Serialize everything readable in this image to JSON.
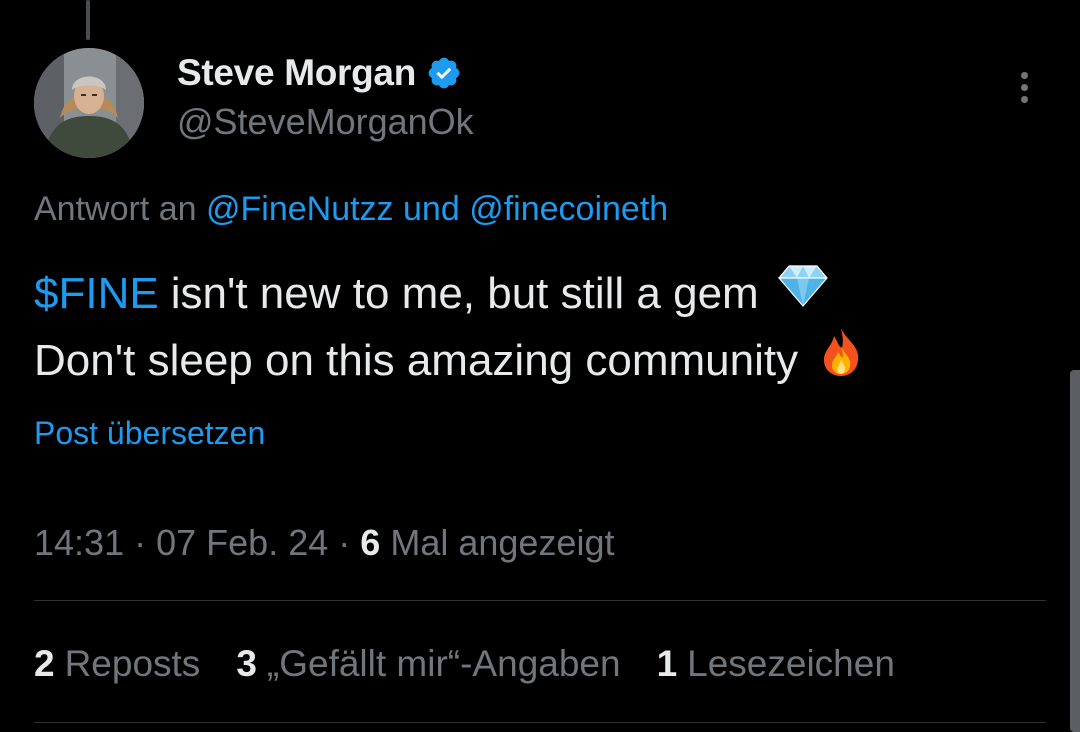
{
  "colors": {
    "background": "#000000",
    "text_primary": "#e7e9ea",
    "text_secondary": "#71767b",
    "accent": "#1d9bf0",
    "divider": "#2f3336"
  },
  "author": {
    "display_name": "Steve Morgan",
    "handle": "@SteveMorganOk",
    "verified": true,
    "avatar_icon": "profile-photo"
  },
  "reply": {
    "prefix": "Antwort an",
    "mention_1": "@FineNutzz",
    "connector": "und",
    "mention_2": "@finecoineth"
  },
  "tweet": {
    "line1_cashtag": "$FINE",
    "line1_text": "isn't new to me, but still a gem",
    "line1_emoji": "gem-stone-icon",
    "line2_text": "Don't sleep on this amazing community",
    "line2_emoji": "fire-icon"
  },
  "translate_label": "Post übersetzen",
  "meta": {
    "time": "14:31",
    "separator": "·",
    "date": "07 Feb. 24",
    "views_count": "6",
    "views_label": "Mal angezeigt"
  },
  "stats": {
    "reposts_count": "2",
    "reposts_label": "Reposts",
    "likes_count": "3",
    "likes_label": "„Gefällt mir“-Angaben",
    "bookmarks_count": "1",
    "bookmarks_label": "Lesezeichen"
  }
}
